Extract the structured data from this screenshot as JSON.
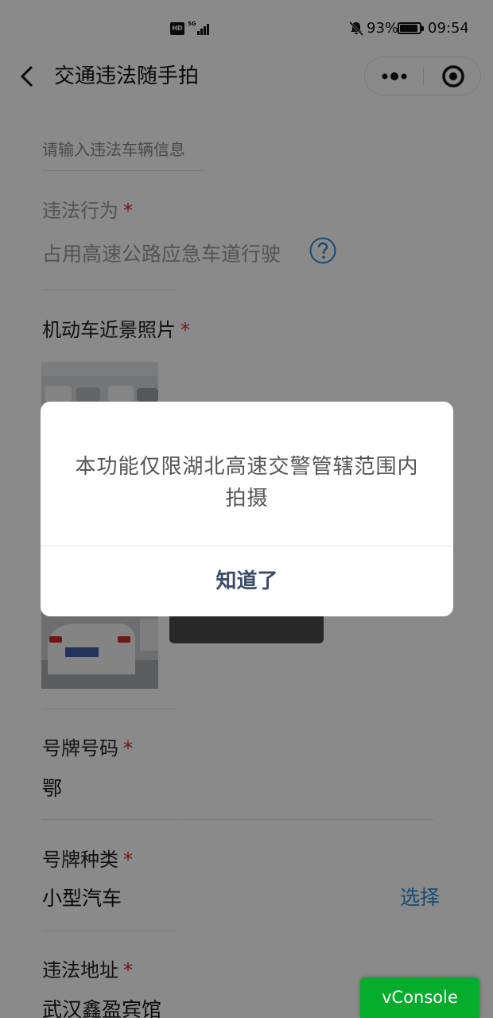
{
  "status_bar": {
    "hd_label": "HD",
    "network_label": "5G",
    "battery_percent": "93%",
    "battery_level": 0.93,
    "time": "09:54"
  },
  "nav": {
    "title": "交通违法随手拍",
    "icons": {
      "back": "chevron-left-icon",
      "more": "more-dots-icon",
      "close": "target-circle-icon"
    }
  },
  "form": {
    "vehicle_info_hint": "请输入违法车辆信息",
    "violation": {
      "label": "违法行为",
      "required_mark": "*",
      "value": "占用高速公路应急车道行驶"
    },
    "photo": {
      "label": "机动车近景照片",
      "required_mark": "*"
    },
    "plate_number": {
      "label": "号牌号码",
      "required_mark": "*",
      "value": "鄂"
    },
    "plate_type": {
      "label": "号牌种类",
      "required_mark": "*",
      "value": "小型汽车",
      "choose_label": "选择"
    },
    "address": {
      "label": "违法地址",
      "required_mark": "*",
      "value": "武汉鑫盈宾馆"
    }
  },
  "dialog": {
    "message": "本功能仅限湖北高速交警管辖范围内拍摄",
    "confirm_label": "知道了"
  },
  "vconsole_label": "vConsole",
  "colors": {
    "accent_link": "#2a8bd6",
    "required": "#d42b2b",
    "vconsole": "#06ad2c",
    "dialog_button": "#3a4a6b"
  }
}
